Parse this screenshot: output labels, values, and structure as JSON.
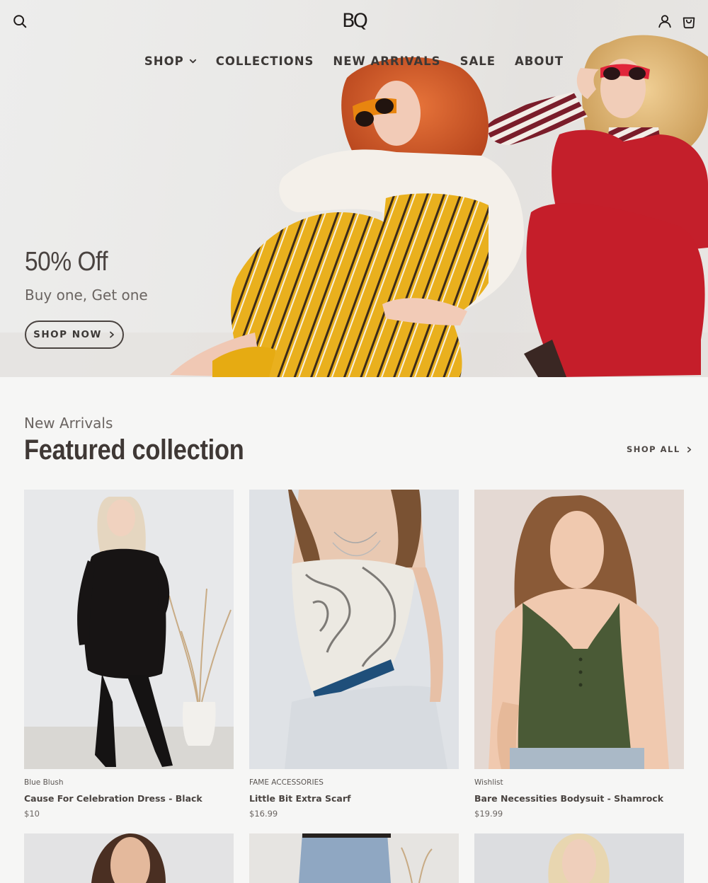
{
  "brand": {
    "logo": "BQ"
  },
  "nav": {
    "items": [
      {
        "label": "SHOP"
      },
      {
        "label": "COLLECTIONS"
      },
      {
        "label": "NEW ARRIVALS"
      },
      {
        "label": "SALE"
      },
      {
        "label": "ABOUT"
      }
    ]
  },
  "hero": {
    "title": "50% Off",
    "subtitle": "Buy one, Get one",
    "cta": "SHOP NOW"
  },
  "featured": {
    "eyebrow": "New Arrivals",
    "title": "Featured collection",
    "shop_all": "SHOP ALL",
    "products": [
      {
        "vendor": "Blue Blush",
        "title": "Cause For Celebration Dress - Black",
        "price": "$10"
      },
      {
        "vendor": "FAME ACCESSORIES",
        "title": "Little Bit Extra Scarf",
        "price": "$16.99"
      },
      {
        "vendor": "Wishlist",
        "title": "Bare Necessities Bodysuit - Shamrock",
        "price": "$19.99"
      }
    ]
  },
  "colors": {
    "text_dark": "#3b3633",
    "background": "#f6f6f5",
    "hero_bg": "#e9e8e6",
    "accent_yellow": "#e8b21c",
    "accent_red": "#c01f2a"
  },
  "icons": [
    "search-icon",
    "account-icon",
    "cart-icon",
    "chevron-down-icon",
    "chevron-right-icon"
  ]
}
